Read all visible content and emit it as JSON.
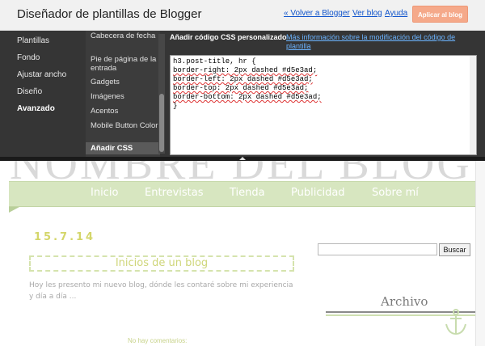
{
  "designer": {
    "title": "Diseñador de plantillas de Blogger",
    "back_link": "« Volver a Blogger",
    "view_blog": "Ver blog",
    "help": "Ayuda",
    "apply_button": "Aplicar al blog"
  },
  "left_nav": [
    "Plantillas",
    "Fondo",
    "Ajustar ancho",
    "Diseño",
    "Avanzado"
  ],
  "left_nav_active": "Avanzado",
  "sub_nav": [
    "Cabecera de fecha",
    "Pie de página de la entrada",
    "Gadgets",
    "Imágenes",
    "Acentos",
    "Mobile Button Color",
    "Añadir CSS"
  ],
  "sub_nav_active": "Añadir CSS",
  "css_panel": {
    "heading": "Añadir código CSS personalizado",
    "help_link": "Más información sobre la modificación del código de plantilla",
    "code_lines": [
      "h3.post-title, hr {",
      "border-right: 2px dashed #d5e3ad;",
      "border-left: 2px dashed #d5e3ad;",
      "border-top: 2px dashed #d5e3ad;",
      "border-bottom: 2px dashed #d5e3ad;",
      "}"
    ]
  },
  "preview": {
    "blog_name": "NOMBRE DEL BLOG",
    "nav_tabs": [
      "Inicio",
      "Entrevistas",
      "Tienda",
      "Publicidad",
      "Sobre mí"
    ],
    "post_date": "15.7.14",
    "post_title": "Inicios de un blog",
    "post_body": "Hoy les presento mi nuevo blog, dónde les contaré sobre mi experiencia y día a día ...",
    "post_comments": "No hay comentarios:",
    "search_value": "",
    "search_button": "Buscar",
    "archive_title": "Archivo"
  },
  "colors": {
    "dashed_border": "#d5e3ad",
    "navbar_bg": "#d7e6c0",
    "apply_button_bg": "#f5a98a",
    "link_blue": "#15c"
  }
}
